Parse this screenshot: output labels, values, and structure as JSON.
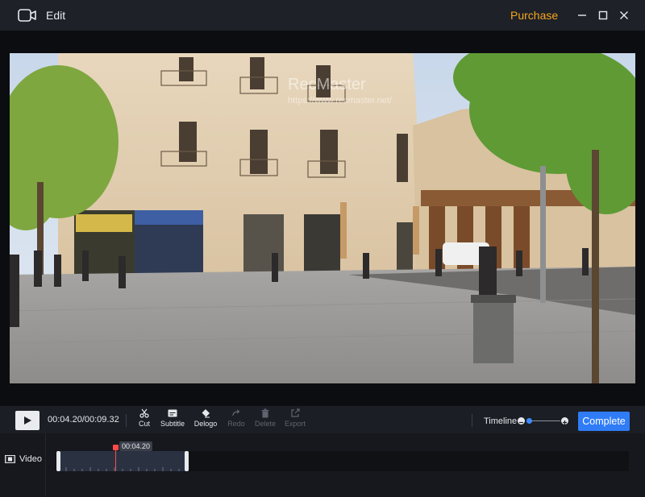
{
  "titlebar": {
    "title": "Edit",
    "purchase_label": "Purchase",
    "icons": [
      "video-camera-icon",
      "minimize-icon",
      "maximize-icon",
      "close-icon"
    ]
  },
  "preview": {
    "watermark_title": "RecMaster",
    "watermark_url": "https://www.recmaster.net/"
  },
  "toolbar": {
    "timecode": "00:04.20/00:09.32",
    "tools": {
      "cut": "Cut",
      "subtitle": "Subtitle",
      "delogo": "Delogo",
      "redo": "Redo",
      "delete": "Delete",
      "export": "Export"
    },
    "timeline_label": "Timeline",
    "complete_label": "Complete"
  },
  "timeline": {
    "track_name": "Video",
    "playhead_time": "00:04.20"
  },
  "colors": {
    "accent": "#2f7cf6",
    "purchase": "#f5a524",
    "playhead": "#ff4a4a",
    "disabled": "#5f6570"
  }
}
